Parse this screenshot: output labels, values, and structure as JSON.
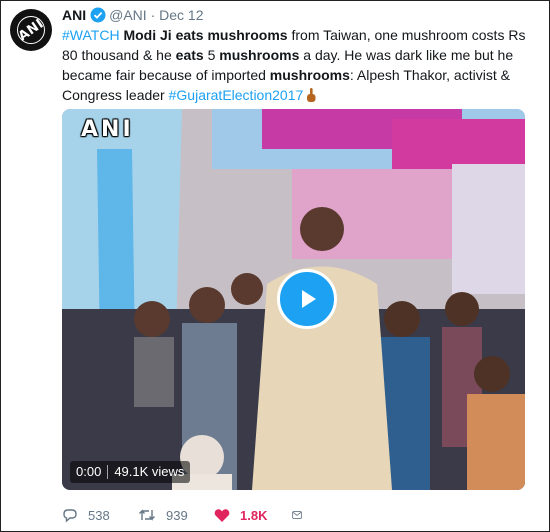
{
  "tweet": {
    "author_name": "ANI",
    "handle": "@ANI",
    "separator": "·",
    "date": "Dec 12",
    "text": {
      "hashtag_watch": "#WATCH",
      "p1": "Modi Ji eats mushrooms",
      "p2": " from Taiwan, one mushroom costs Rs 80 thousand & he ",
      "p3": "eats",
      "p4": " 5 ",
      "p5": "mushrooms",
      "p6": " a day. He was dark like me but he became fair because of imported ",
      "p7": "mushrooms",
      "p8": ": Alpesh Thakor, activist & Congress leader",
      "hashtag_election": "#GujaratElection2017"
    }
  },
  "avatar": {
    "logo": "ANI"
  },
  "media": {
    "watermark": "ANI",
    "time": "0:00",
    "views": "49.1K views"
  },
  "actions": {
    "replies": "538",
    "retweets": "939",
    "likes": "1.8K"
  },
  "colors": {
    "link": "#1da1f2",
    "like": "#e0245e",
    "meta": "#657786"
  },
  "icons": [
    "reply-icon",
    "retweet-icon",
    "heart-icon",
    "message-icon",
    "play-icon",
    "verified-icon",
    "pointing-hand-emoji"
  ]
}
